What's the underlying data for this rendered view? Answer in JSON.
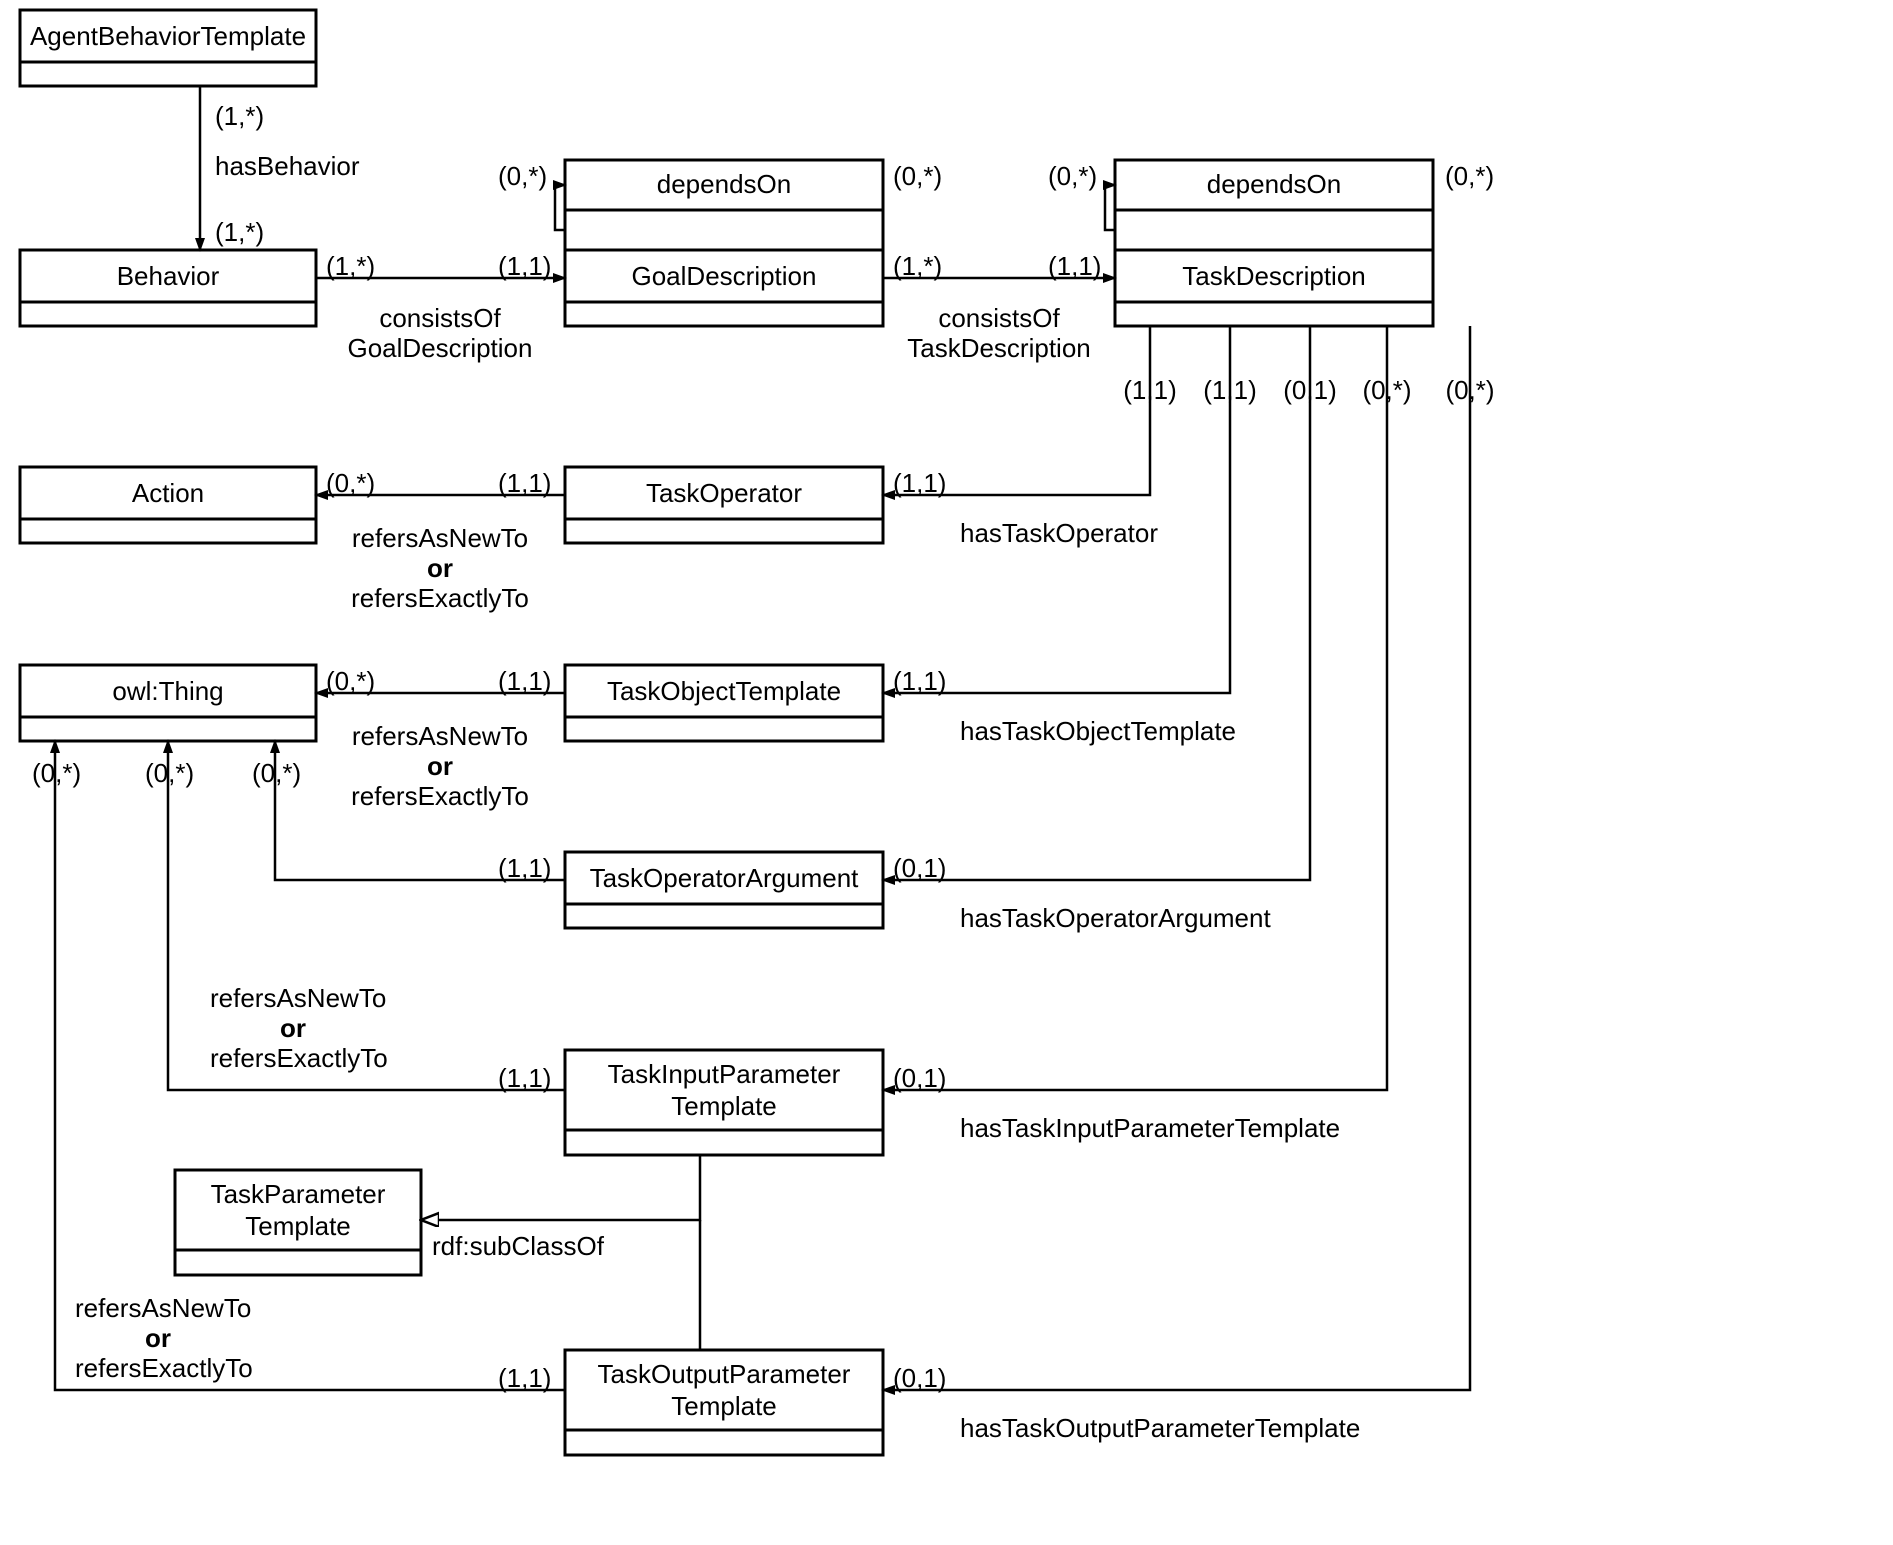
{
  "classes": {
    "agentBehaviorTemplate": "AgentBehaviorTemplate",
    "behavior": "Behavior",
    "goalDescription": "GoalDescription",
    "taskDescription": "TaskDescription",
    "action": "Action",
    "taskOperator": "TaskOperator",
    "owlThing": "owl:Thing",
    "taskObjectTemplate": "TaskObjectTemplate",
    "taskOperatorArgument": "TaskOperatorArgument",
    "taskInputParameterTemplate": "TaskInputParameter\nTemplate",
    "taskParameterTemplate": "TaskParameter\nTemplate",
    "taskOutputParameterTemplate": "TaskOutputParameter\nTemplate"
  },
  "relations": {
    "hasBehavior": "hasBehavior",
    "consistsOfGoal1": "consistsOf",
    "consistsOfGoal2": "GoalDescription",
    "consistsOfTask1": "consistsOf",
    "consistsOfTask2": "TaskDescription",
    "dependsOnGoal": "dependsOn",
    "dependsOnTask": "dependsOn",
    "hasTaskOperator": "hasTaskOperator",
    "hasTaskObjectTemplate": "hasTaskObjectTemplate",
    "hasTaskOperatorArgument": "hasTaskOperatorArgument",
    "hasTaskInputParameterTemplate": "hasTaskInputParameterTemplate",
    "hasTaskOutputParameterTemplate": "hasTaskOutputParameterTemplate",
    "refersAsNewTo": "refersAsNewTo",
    "or": "or",
    "refersExactlyTo": "refersExactlyTo",
    "subClassOf": "rdf:subClassOf"
  },
  "card": {
    "c0s": "(0,*)",
    "c1s": "(1,*)",
    "c11": "(1,1)",
    "c01": "(0,1)"
  }
}
